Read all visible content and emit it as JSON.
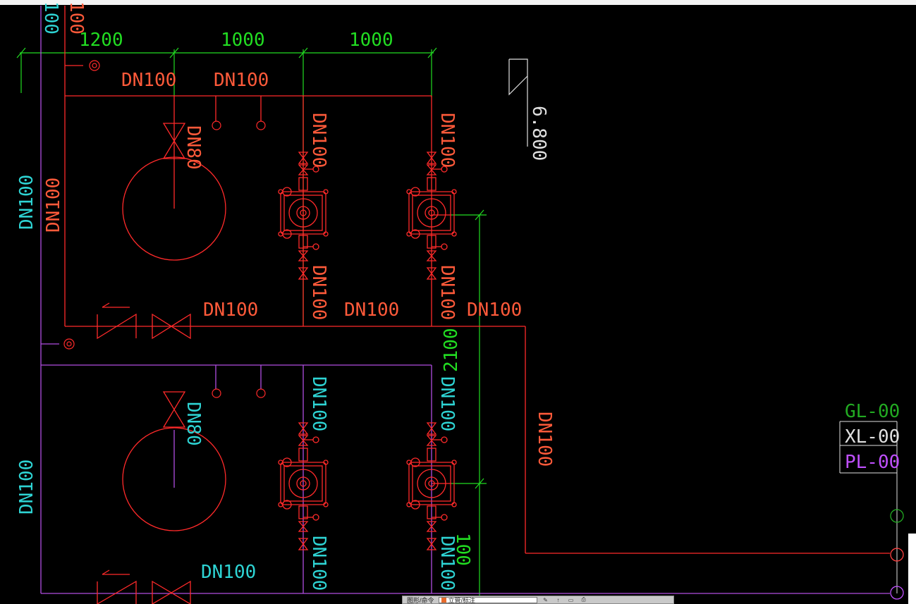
{
  "colors": {
    "background": "#000000",
    "pipe_red": "#ff2a2a",
    "pipe_purple": "#b04de0",
    "dimension_green": "#22dd22",
    "text_cyan": "#2ed4d4",
    "text_orange": "#ff5a3a",
    "text_white": "#e0e0e0",
    "legend_green": "#22aa22",
    "legend_red": "#ff4040",
    "legend_purple": "#c050ff"
  },
  "drawing": {
    "top_dim": "100",
    "top_dim_2": "100",
    "dims": {
      "d1": "1200",
      "d2": "1000",
      "d3": "1000"
    },
    "vertical_dim": "2100",
    "elevation": "6.800",
    "labels": {
      "dn100": "DN100",
      "dn80": "DN80"
    },
    "pumps": [
      {
        "id": "pump-upper-1"
      },
      {
        "id": "pump-upper-2"
      },
      {
        "id": "pump-lower-1"
      },
      {
        "id": "pump-lower-2"
      }
    ],
    "legend": [
      {
        "code": "GL-00",
        "color": "#22aa22"
      },
      {
        "code": "XL-00",
        "color": "#e0e0e0"
      },
      {
        "code": "PL-00",
        "color": "#c050ff"
      }
    ]
  },
  "statusbar": {
    "label": "图形/命令",
    "field_text": "立管/标注",
    "icons": [
      "pencil-icon",
      "arrow-up-icon",
      "layer-icon",
      "print-icon"
    ]
  }
}
